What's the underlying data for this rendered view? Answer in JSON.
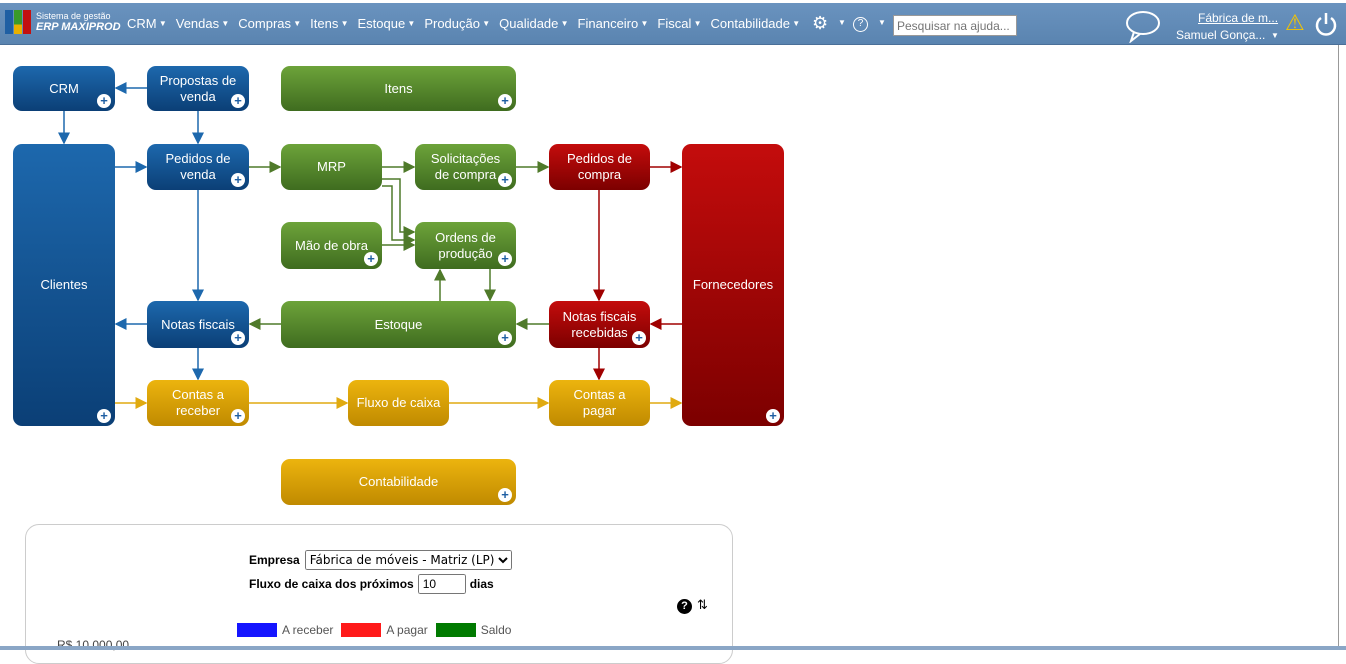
{
  "header": {
    "logo_line1": "Sistema de gestão",
    "logo_line2": "ERP MAXIPROD",
    "menu": [
      "CRM",
      "Vendas",
      "Compras",
      "Itens",
      "Estoque",
      "Produção",
      "Qualidade",
      "Financeiro",
      "Fiscal",
      "Contabilidade"
    ],
    "search_placeholder": "Pesquisar na ajuda...",
    "company": "Fábrica de m...",
    "user": "Samuel Gonça..."
  },
  "diagram": {
    "crm": "CRM",
    "propostas": "Propostas de venda",
    "itens": "Itens",
    "clientes": "Clientes",
    "pedidos_venda": "Pedidos de venda",
    "mrp": "MRP",
    "solicitacoes": "Solicitações de compra",
    "pedidos_compra": "Pedidos de compra",
    "fornecedores": "Fornecedores",
    "mao_obra": "Mão de obra",
    "ordens": "Ordens de produção",
    "notas_fiscais": "Notas fiscais",
    "estoque": "Estoque",
    "nf_recebidas": "Notas fiscais recebidas",
    "contas_receber": "Contas a receber",
    "fluxo": "Fluxo de caixa",
    "contas_pagar": "Contas a pagar",
    "contabilidade": "Contabilidade"
  },
  "colors": {
    "blue": "#0b3f76",
    "green": "#4f8129",
    "red": "#a00000",
    "gold": "#d9a000",
    "nav": "#5f89b5"
  },
  "cashflow": {
    "empresa_label": "Empresa",
    "empresa_value": "Fábrica de móveis - Matriz (LP)",
    "days_label": "Fluxo de caixa dos próximos",
    "days_value": "10",
    "days_unit": "dias",
    "legend": [
      {
        "label": "A receber",
        "color": "#1515ff"
      },
      {
        "label": "A pagar",
        "color": "#ff1a1a"
      },
      {
        "label": "Saldo",
        "color": "#007a00"
      }
    ],
    "y_tick": "R$ 10.000,00"
  }
}
